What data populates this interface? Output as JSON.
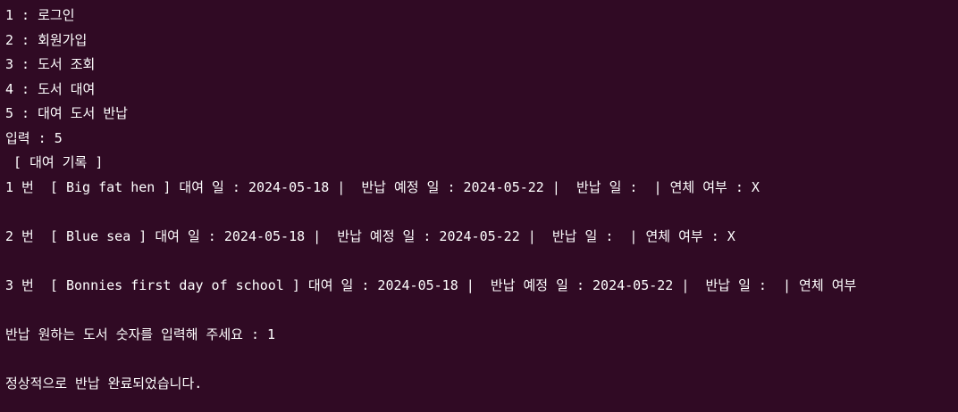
{
  "terminal": {
    "background": "#300a24",
    "foreground": "#ffffff",
    "lines": [
      "1 : 로그인",
      "2 : 회원가입",
      "3 : 도서 조회",
      "4 : 도서 대여",
      "5 : 대여 도서 반납",
      "입력 : 5",
      " [ 대여 기록 ]",
      "1 번  [ Big fat hen ] 대여 일 : 2024-05-18 |  반납 예정 일 : 2024-05-22 |  반납 일 :  | 연체 여부 : X",
      "",
      "2 번  [ Blue sea ] 대여 일 : 2024-05-18 |  반납 예정 일 : 2024-05-22 |  반납 일 :  | 연체 여부 : X",
      "",
      "3 번  [ Bonnies first day of school ] 대여 일 : 2024-05-18 |  반납 예정 일 : 2024-05-22 |  반납 일 :  | 연체 여부",
      "",
      "반납 원하는 도서 숫자를 입력해 주세요 : 1",
      "",
      "정상적으로 반납 완료되었습니다."
    ]
  }
}
